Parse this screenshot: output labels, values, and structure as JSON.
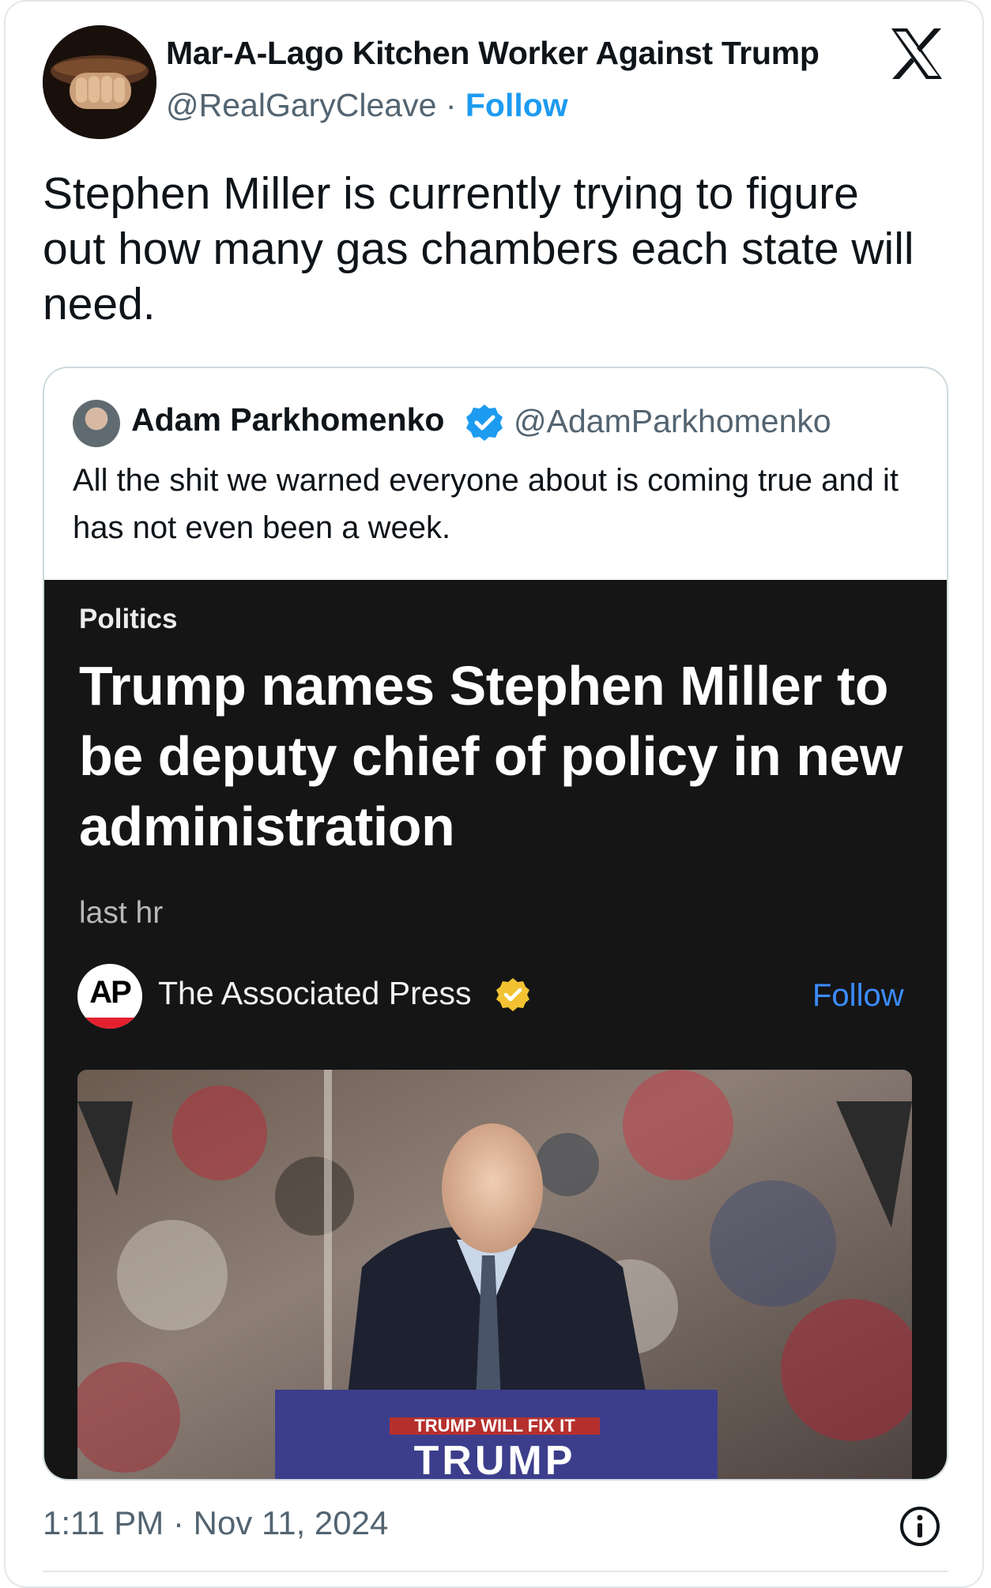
{
  "tweet": {
    "author_name": "Mar-A-Lago Kitchen Worker Against Trump",
    "handle": "@RealGaryCleave",
    "separator": " · ",
    "follow_label": "Follow",
    "text": "Stephen Miller is currently trying to figure out how many gas chambers each state will need.",
    "timestamp": "1:11 PM · Nov 11, 2024"
  },
  "quote": {
    "author_name": "Adam Parkhomenko",
    "handle": "@AdamParkhomenko",
    "text": "All the shit we warned everyone about is coming true and it has not even been a week."
  },
  "article": {
    "category": "Politics",
    "headline": "Trump names Stephen Miller to be deputy chief of policy in new administration",
    "time": "last hr",
    "source_logo_text": "AP",
    "source": "The Associated Press",
    "follow_label": "Follow",
    "podium_slogan": "TRUMP WILL FIX IT",
    "podium_name": "TRUMP"
  },
  "icons": {
    "platform_logo": "x-logo-icon",
    "verified": "verified-badge-icon",
    "info": "info-icon"
  },
  "colors": {
    "accent": "#1d9bf0",
    "secondary_text": "#536471",
    "article_bg": "#151515",
    "ap_follow": "#3c8cff",
    "ap_red": "#e5202e",
    "gold_badge": "#f2c233"
  }
}
